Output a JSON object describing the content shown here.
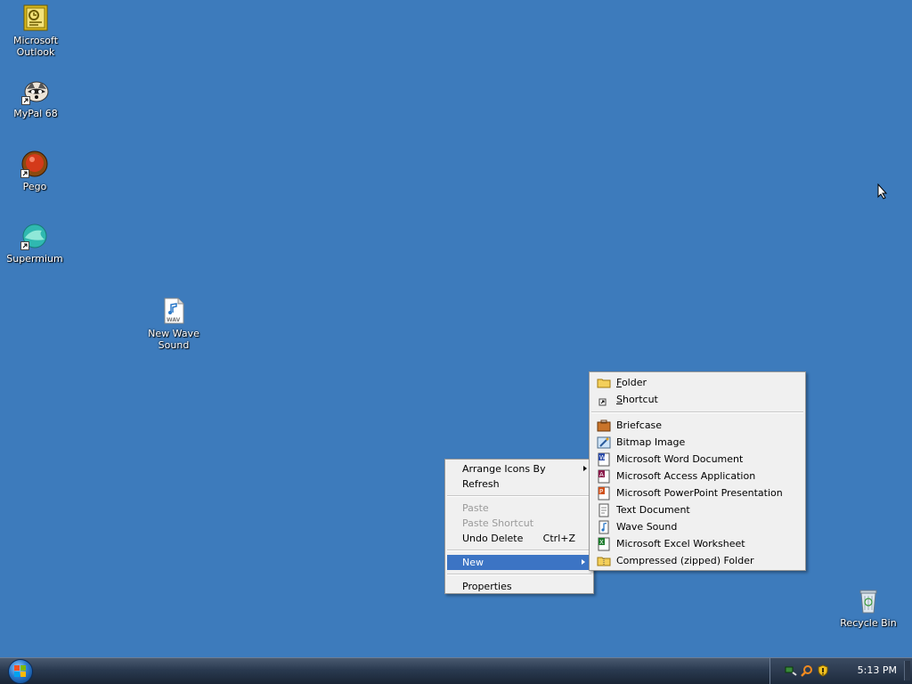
{
  "desktop": {
    "icons": [
      {
        "label_line1": "Microsoft",
        "label_line2": "Outlook"
      },
      {
        "label_line1": "MyPal 68",
        "label_line2": ""
      },
      {
        "label_line1": "Pego",
        "label_line2": ""
      },
      {
        "label_line1": "Supermium",
        "label_line2": ""
      },
      {
        "label_line1": "New Wave",
        "label_line2": "Sound",
        "badge": "WAV"
      },
      {
        "label_line1": "Recycle Bin",
        "label_line2": ""
      }
    ]
  },
  "context_menu": {
    "items": [
      {
        "label": "Arrange Icons By"
      },
      {
        "label": "Refresh"
      },
      {
        "label": "Paste"
      },
      {
        "label": "Paste Shortcut"
      },
      {
        "label": "Undo Delete",
        "shortcut": "Ctrl+Z"
      },
      {
        "label": "New"
      },
      {
        "label": "Properties"
      }
    ]
  },
  "new_submenu": {
    "items": [
      {
        "label_u": "F",
        "label_rest": "older",
        "icon": "folder-icon"
      },
      {
        "label_u": "S",
        "label_rest": "hortcut",
        "icon": "shortcut-icon"
      },
      {
        "label": "Briefcase",
        "icon": "briefcase-icon"
      },
      {
        "label": "Bitmap Image",
        "icon": "bitmap-image-icon"
      },
      {
        "label": "Microsoft Word Document",
        "icon": "word-document-icon"
      },
      {
        "label": "Microsoft Access Application",
        "icon": "access-application-icon"
      },
      {
        "label": "Microsoft PowerPoint Presentation",
        "icon": "powerpoint-presentation-icon"
      },
      {
        "label": "Text Document",
        "icon": "text-document-icon"
      },
      {
        "label": "Wave Sound",
        "icon": "wave-sound-icon"
      },
      {
        "label": "Microsoft Excel Worksheet",
        "icon": "excel-worksheet-icon"
      },
      {
        "label": "Compressed (zipped) Folder",
        "icon": "zipped-folder-icon"
      }
    ]
  },
  "taskbar": {
    "clock": "5:13 PM"
  },
  "colors": {
    "desktop_bg": "#3d7bbc",
    "menu_highlight": "#3c74c4"
  }
}
